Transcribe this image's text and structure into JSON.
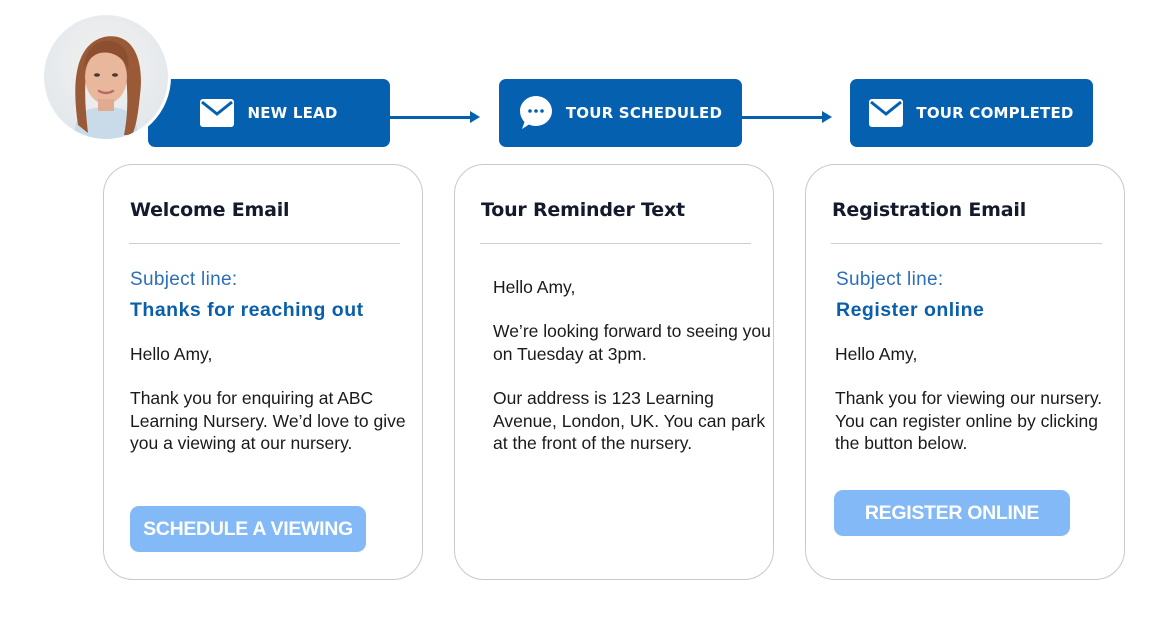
{
  "avatar": {
    "alt": "Lead contact photo"
  },
  "stages": [
    {
      "label": "NEW LEAD",
      "icon": "envelope-icon"
    },
    {
      "label": "TOUR SCHEDULED",
      "icon": "chat-bubble-icon"
    },
    {
      "label": "TOUR COMPLETED",
      "icon": "envelope-icon"
    }
  ],
  "cards": [
    {
      "title": "Welcome Email",
      "subject_label": "Subject line:",
      "subject_value": "Thanks for reaching out",
      "greeting": "Hello Amy,",
      "body": "Thank you for enquiring at ABC Learning Nursery. We’d love to give you a viewing at our nursery.",
      "button_label": "SCHEDULE A VIEWING"
    },
    {
      "title": "Tour Reminder Text",
      "greeting": "Hello Amy,",
      "body_1": "We’re looking forward to seeing you on Tuesday at 3pm.",
      "body_2": "Our address is 123 Learning Avenue, London, UK. You can park at the front of the nursery."
    },
    {
      "title": "Registration Email",
      "subject_label": "Subject line:",
      "subject_value": "Register online",
      "greeting": "Hello Amy,",
      "body": "Thank you for viewing our nursery. You can register online by clicking the button below.",
      "button_label": "REGISTER ONLINE"
    }
  ],
  "colors": {
    "stage_blue": "#0560b0",
    "subject_blue": "#0a5fab",
    "button_light_blue": "#84b9f7",
    "title_dark": "#141a2c"
  }
}
